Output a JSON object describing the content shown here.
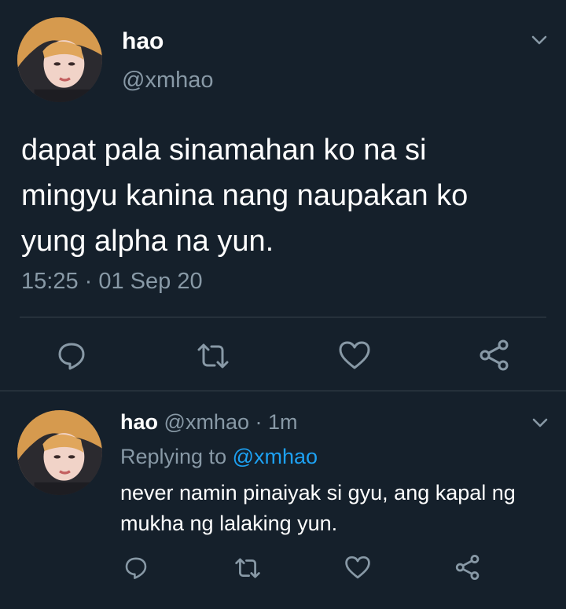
{
  "main_tweet": {
    "author_name": "hao",
    "author_handle": "@xmhao",
    "text": "dapat pala sinamahan ko na si\nmingyu kanina nang naupakan ko\nyung alpha na yun.",
    "timestamp": "15:25 · 01 Sep 20",
    "actions": {
      "reply_icon": "reply-icon",
      "retweet_icon": "retweet-icon",
      "like_icon": "heart-icon",
      "share_icon": "share-icon"
    }
  },
  "reply_tweet": {
    "author_name": "hao",
    "author_handle": "@xmhao",
    "separator": "·",
    "age": "1m",
    "replying_label": "Replying to",
    "replying_to": "@xmhao",
    "text": "never namin pinaiyak si gyu, ang kapal ng mukha ng lalaking yun."
  },
  "colors": {
    "background": "#15202b",
    "primary_text": "#ffffff",
    "secondary_text": "#8899a6",
    "accent": "#1da1f2",
    "divider": "#38444d"
  }
}
